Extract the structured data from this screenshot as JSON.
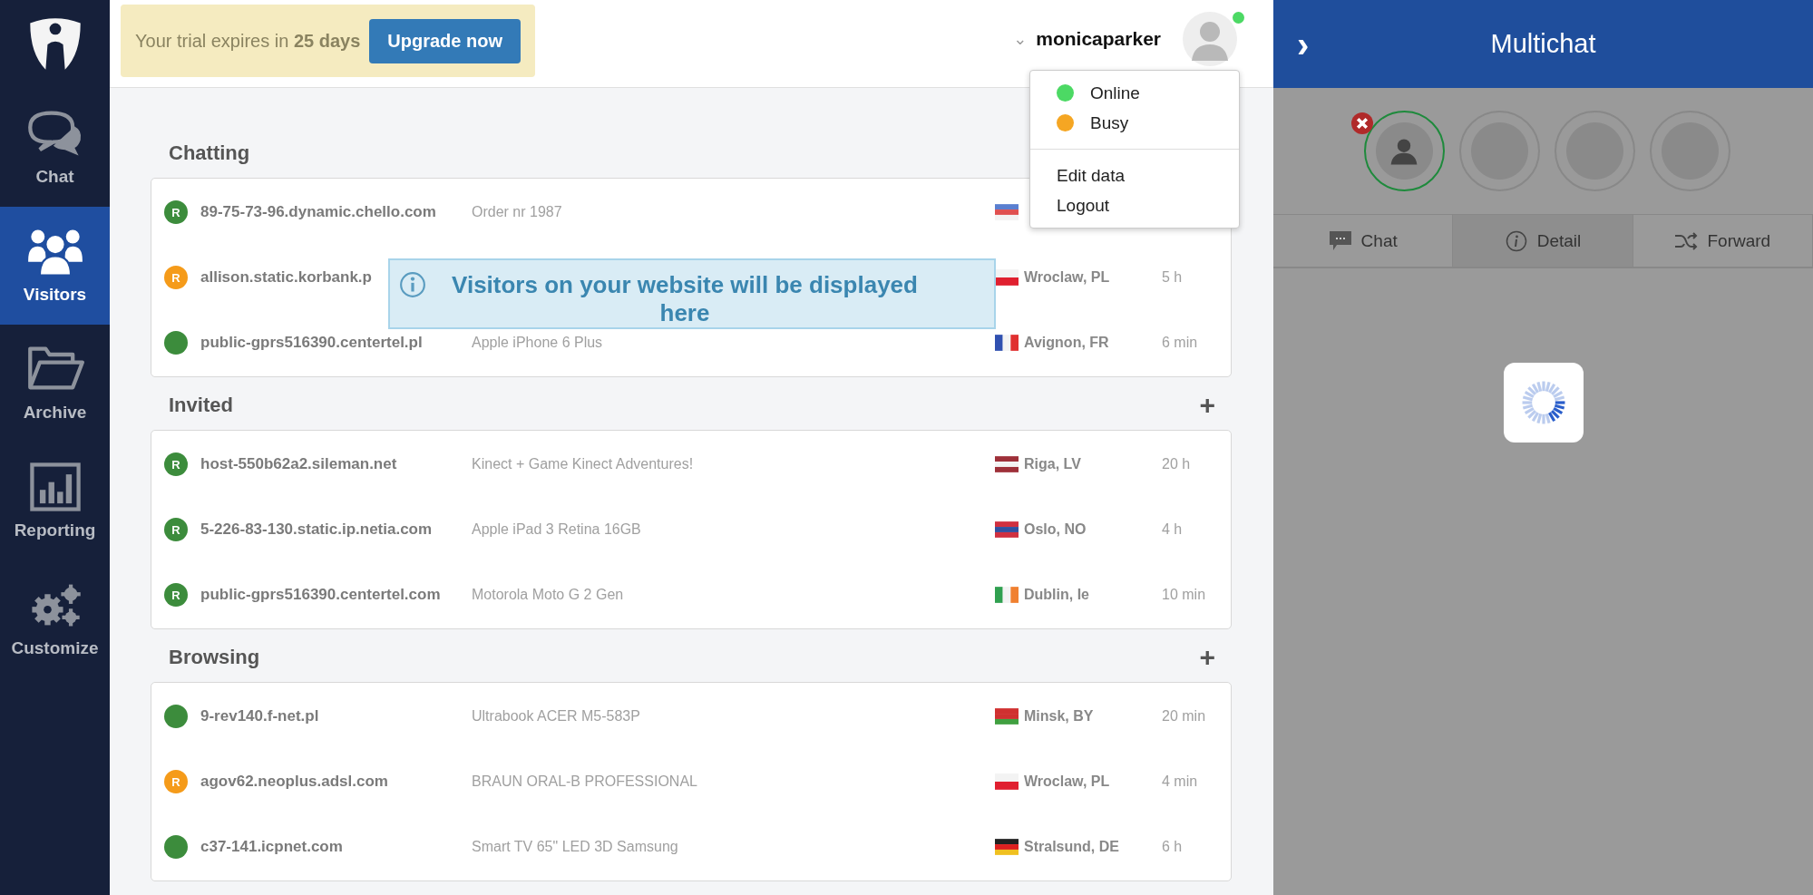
{
  "sidebar": {
    "items": [
      {
        "kind": "chat",
        "label": "Chat",
        "selected": false
      },
      {
        "kind": "visitors",
        "label": "Visitors",
        "selected": true
      },
      {
        "kind": "archive",
        "label": "Archive",
        "selected": false
      },
      {
        "kind": "reporting",
        "label": "Reporting",
        "selected": false
      },
      {
        "kind": "customize",
        "label": "Customize",
        "selected": false
      }
    ]
  },
  "trial_banner": {
    "text": "Your trial expires in **25 days**",
    "button": "Upgrade now"
  },
  "user": {
    "caret": "⌄",
    "name": "monicaparker",
    "online": true
  },
  "status_menu": {
    "statuses": [
      {
        "label": "Online",
        "color": "#4cd964"
      },
      {
        "label": "Busy",
        "color": "#f5a623"
      }
    ],
    "actions": [
      "Edit data",
      "Logout"
    ]
  },
  "sections": [
    {
      "title": "Chatting",
      "rows": [
        {
          "color": "#3c8c3c",
          "badge": "R",
          "host": "89-75-73-96.dynamic.chello.com",
          "device": "Order nr 1987",
          "flag": {
            "kind": "horizontal",
            "stripes": [
              {
                "color": "#5a7fd0"
              },
              {
                "color": "#e05050"
              },
              {
                "color": "#f3f3f3"
              }
            ]
          }
        },
        {
          "color": "#f59b1a",
          "badge": "R",
          "host": "allison.static.korbank.p",
          "location": "Wroclaw, PL",
          "time": "5 h",
          "flag": {
            "kind": "horizontal",
            "stripes": [
              {
                "color": "#f3f3f3"
              },
              {
                "color": "#e02030"
              }
            ]
          }
        },
        {
          "color": "#3c8c3c",
          "host": "public-gprs516390.centertel.pl",
          "device": "Apple iPhone 6 Plus",
          "location": "Avignon, FR",
          "time": "6 min",
          "flag": {
            "kind": "vertical",
            "stripes": [
              {
                "color": "#3050b0"
              },
              {
                "color": "#f3f3f3"
              },
              {
                "color": "#e03030"
              }
            ]
          }
        }
      ],
      "notice": "Visitors on your website will be displayed here"
    },
    {
      "title": "Invited",
      "add": "+",
      "rows": [
        {
          "color": "#3c8c3c",
          "badge": "R",
          "host": "host-550b62a2.sileman.net",
          "device": "Kinect + Game Kinect Adventures!",
          "location": "Riga, LV",
          "time": "20 h",
          "flag": {
            "kind": "horizontal",
            "stripes": [
              {
                "color": "#9e3039"
              },
              {
                "color": "#f3f3f3"
              },
              {
                "color": "#9e3039"
              }
            ]
          }
        },
        {
          "color": "#3c8c3c",
          "badge": "R",
          "host": "5-226-83-130.static.ip.netia.com",
          "device": "Apple iPad 3 Retina 16GB",
          "location": "Oslo, NO",
          "time": "4 h",
          "flag": {
            "kind": "horizontal",
            "stripes": [
              {
                "color": "#d03040"
              },
              {
                "color": "#3050a0"
              },
              {
                "color": "#d03040"
              }
            ]
          }
        },
        {
          "color": "#3c8c3c",
          "badge": "R",
          "host": "public-gprs516390.centertel.com",
          "device": "Motorola Moto G 2 Gen",
          "location": "Dublin, Ie",
          "time": "10 min",
          "flag": {
            "kind": "vertical",
            "stripes": [
              {
                "color": "#30a050"
              },
              {
                "color": "#f3f3f3"
              },
              {
                "color": "#f08030"
              }
            ]
          }
        }
      ]
    },
    {
      "title": "Browsing",
      "add": "+",
      "rows": [
        {
          "color": "#3c8c3c",
          "host": "9-rev140.f-net.pl",
          "device": "Ultrabook ACER M5-583P",
          "location": "Minsk, BY",
          "time": "20 min",
          "flag": {
            "kind": "horizontal",
            "stripes": [
              {
                "color": "#d03030"
              },
              {
                "color": "#d03030"
              },
              {
                "color": "#40a040"
              }
            ]
          }
        },
        {
          "color": "#f59b1a",
          "badge": "R",
          "host": "agov62.neoplus.adsl.com",
          "device": "BRAUN ORAL-B PROFESSIONAL",
          "location": "Wroclaw, PL",
          "time": "4 min",
          "flag": {
            "kind": "horizontal",
            "stripes": [
              {
                "color": "#f3f3f3"
              },
              {
                "color": "#e02030"
              }
            ]
          }
        },
        {
          "color": "#3c8c3c",
          "host": "c37-141.icpnet.com",
          "device": "Smart TV 65\" LED 3D Samsung",
          "location": "Stralsund, DE",
          "time": "6 h",
          "flag": {
            "kind": "horizontal",
            "stripes": [
              {
                "color": "#222222"
              },
              {
                "color": "#dd2020"
              },
              {
                "color": "#f0c020"
              }
            ]
          }
        }
      ]
    }
  ],
  "multichat": {
    "toggle": "›",
    "title": "Multichat",
    "slots": [
      {
        "kind": "visitor",
        "selected": true
      },
      {
        "kind": "empty",
        "selected": false
      },
      {
        "kind": "empty",
        "selected": false
      },
      {
        "kind": "empty",
        "selected": false
      }
    ],
    "tabs": [
      {
        "kind": "chat",
        "label": "Chat",
        "selected": false
      },
      {
        "kind": "detail",
        "label": "Detail",
        "selected": true
      },
      {
        "kind": "forward",
        "label": "Forward",
        "selected": false
      }
    ],
    "loading": true
  }
}
